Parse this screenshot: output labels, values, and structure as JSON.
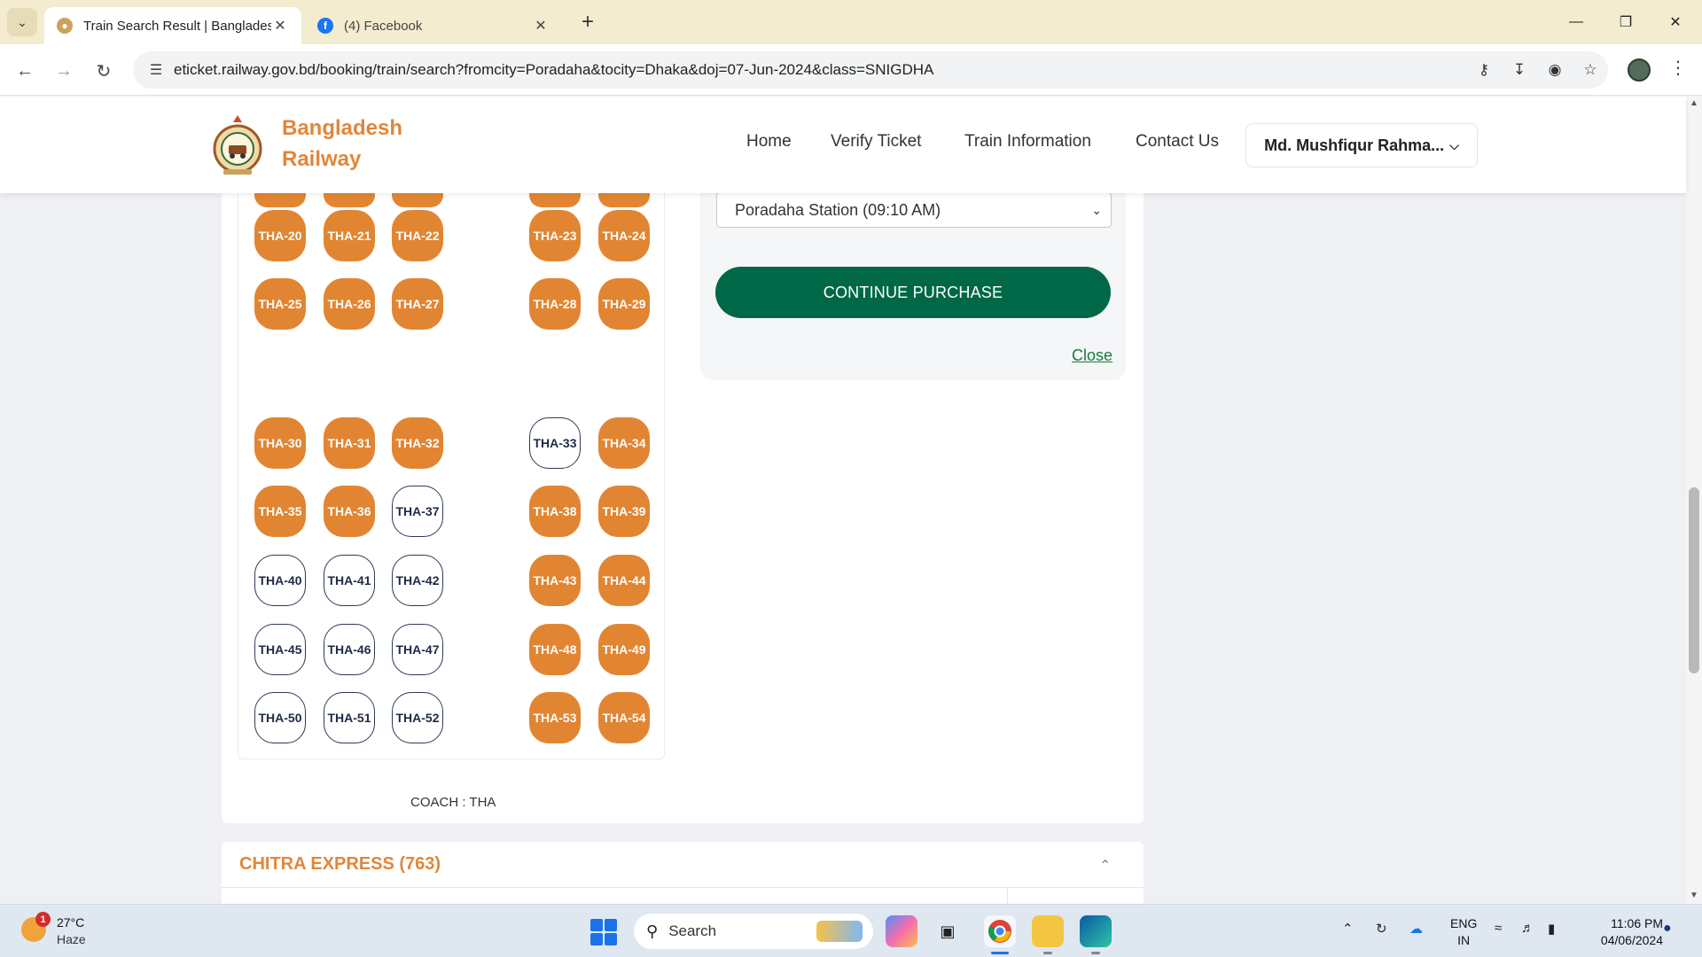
{
  "browser": {
    "tabs": [
      {
        "title": "Train Search Result | Bangladesh",
        "active": true,
        "icon": "railway-favicon"
      },
      {
        "title": "(4) Facebook",
        "active": false,
        "icon": "facebook-icon"
      }
    ],
    "url": "eticket.railway.gov.bd/booking/train/search?fromcity=Poradaha&tocity=Dhaka&doj=07-Jun-2024&class=SNIGDHA"
  },
  "site": {
    "brand_line1": "Bangladesh",
    "brand_line2": "Railway",
    "menu": [
      "Home",
      "Verify Ticket",
      "Train Information",
      "Contact Us"
    ],
    "user_name": "Md. Mushfiqur Rahma..."
  },
  "seat_map": {
    "coach_label": "COACH : THA",
    "seats": [
      {
        "id": "THA-20",
        "status": "booked"
      },
      {
        "id": "THA-21",
        "status": "booked"
      },
      {
        "id": "THA-22",
        "status": "booked"
      },
      {
        "id": "THA-23",
        "status": "booked"
      },
      {
        "id": "THA-24",
        "status": "booked"
      },
      {
        "id": "THA-25",
        "status": "booked"
      },
      {
        "id": "THA-26",
        "status": "booked"
      },
      {
        "id": "THA-27",
        "status": "booked"
      },
      {
        "id": "THA-28",
        "status": "booked"
      },
      {
        "id": "THA-29",
        "status": "booked"
      },
      {
        "id": "THA-30",
        "status": "booked"
      },
      {
        "id": "THA-31",
        "status": "booked"
      },
      {
        "id": "THA-32",
        "status": "booked"
      },
      {
        "id": "THA-33",
        "status": "available"
      },
      {
        "id": "THA-34",
        "status": "booked"
      },
      {
        "id": "THA-35",
        "status": "booked"
      },
      {
        "id": "THA-36",
        "status": "booked"
      },
      {
        "id": "THA-37",
        "status": "available"
      },
      {
        "id": "THA-38",
        "status": "booked"
      },
      {
        "id": "THA-39",
        "status": "booked"
      },
      {
        "id": "THA-40",
        "status": "available"
      },
      {
        "id": "THA-41",
        "status": "available"
      },
      {
        "id": "THA-42",
        "status": "available"
      },
      {
        "id": "THA-43",
        "status": "booked"
      },
      {
        "id": "THA-44",
        "status": "booked"
      },
      {
        "id": "THA-45",
        "status": "available"
      },
      {
        "id": "THA-46",
        "status": "available"
      },
      {
        "id": "THA-47",
        "status": "available"
      },
      {
        "id": "THA-48",
        "status": "booked"
      },
      {
        "id": "THA-49",
        "status": "booked"
      },
      {
        "id": "THA-50",
        "status": "available"
      },
      {
        "id": "THA-51",
        "status": "available"
      },
      {
        "id": "THA-52",
        "status": "available"
      },
      {
        "id": "THA-53",
        "status": "booked"
      },
      {
        "id": "THA-54",
        "status": "booked"
      }
    ]
  },
  "purchase": {
    "boarding_station": "Poradaha Station (09:10 AM)",
    "continue_label": "CONTINUE PURCHASE",
    "close_label": "Close"
  },
  "next_train": {
    "name": "CHITRA EXPRESS (763)"
  },
  "colors": {
    "booked_seat": "#e28532",
    "brand_orange": "#e0873a",
    "continue_green": "#006847"
  },
  "taskbar": {
    "weather_temp": "27°C",
    "weather_cond": "Haze",
    "weather_badge": "1",
    "search_label": "Search",
    "lang_line1": "ENG",
    "lang_line2": "IN",
    "time": "11:06 PM",
    "date": "04/06/2024"
  }
}
